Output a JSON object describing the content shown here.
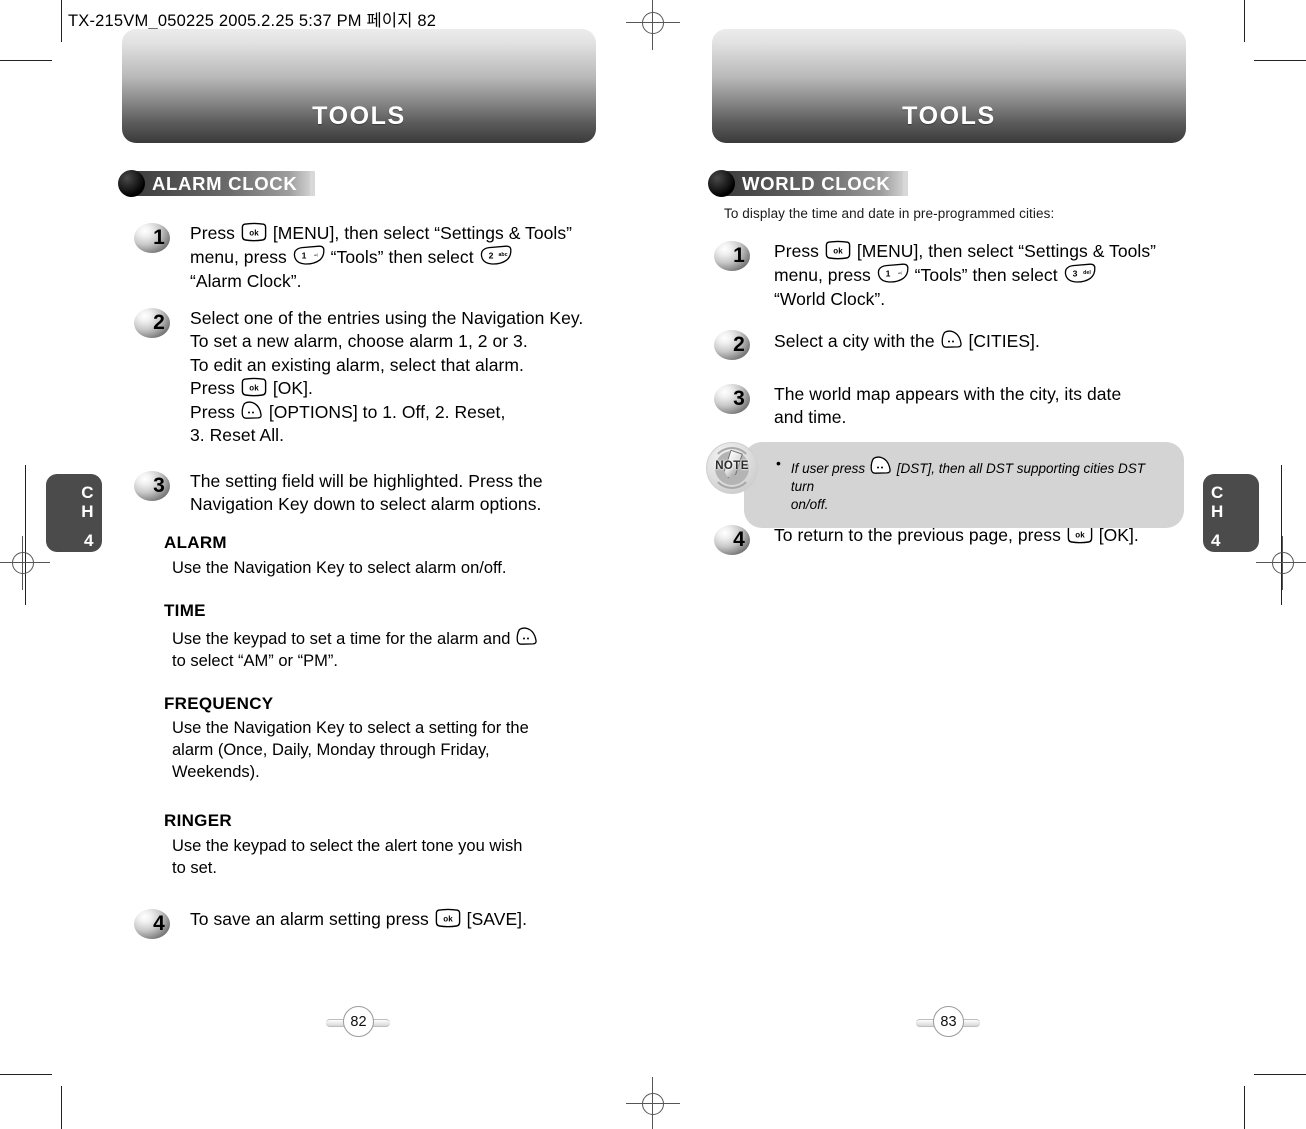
{
  "document": {
    "header_line": "TX-215VM_050225  2005.2.25 5:37 PM 페이지 82"
  },
  "chapter_tabs": {
    "left": {
      "c": "C",
      "h": "H",
      "num": "4"
    },
    "right": {
      "c": "C",
      "h": "H",
      "num": "4"
    }
  },
  "pages": [
    {
      "banner_title": "TOOLS",
      "page_number": "82",
      "section": {
        "label": "ALARM CLOCK"
      },
      "intro": "",
      "steps": [
        {
          "number": "1",
          "lines": [
            {
              "parts": [
                {
                  "type": "text",
                  "value": "Press "
                },
                {
                  "type": "key",
                  "key": "ok",
                  "label": "ok"
                },
                {
                  "type": "text",
                  "value": " [MENU], then select “Settings & Tools”"
                }
              ]
            },
            {
              "parts": [
                {
                  "type": "text",
                  "value": "menu, press "
                },
                {
                  "type": "key",
                  "key": "num",
                  "label": "1",
                  "sub": "₀₍"
                },
                {
                  "type": "text",
                  "value": " “Tools” then select "
                },
                {
                  "type": "key",
                  "key": "num",
                  "label": "2",
                  "sub": "abc"
                }
              ]
            },
            {
              "parts": [
                {
                  "type": "text",
                  "value": "“Alarm Clock”."
                }
              ]
            }
          ]
        },
        {
          "number": "2",
          "lines": [
            {
              "parts": [
                {
                  "type": "text",
                  "value": "Select one of the entries using the Navigation Key."
                }
              ]
            },
            {
              "parts": [
                {
                  "type": "text",
                  "value": "To set a new alarm, choose alarm 1, 2 or 3."
                }
              ]
            },
            {
              "parts": [
                {
                  "type": "text",
                  "value": "To edit an existing alarm, select that alarm."
                }
              ]
            },
            {
              "parts": [
                {
                  "type": "text",
                  "value": "Press "
                },
                {
                  "type": "key",
                  "key": "ok",
                  "label": "ok"
                },
                {
                  "type": "text",
                  "value": " [OK]."
                }
              ]
            },
            {
              "parts": [
                {
                  "type": "text",
                  "value": "Press "
                },
                {
                  "type": "key",
                  "key": "soft"
                },
                {
                  "type": "text",
                  "value": " [OPTIONS] to 1. Off, 2. Reset,"
                }
              ]
            },
            {
              "parts": [
                {
                  "type": "text",
                  "value": "3. Reset All."
                }
              ]
            }
          ]
        },
        {
          "number": "3",
          "lines": [
            {
              "parts": [
                {
                  "type": "text",
                  "value": "The setting field will be highlighted. Press the"
                }
              ]
            },
            {
              "parts": [
                {
                  "type": "text",
                  "value": "Navigation Key down to select alarm options."
                }
              ]
            }
          ]
        },
        {
          "number": "4",
          "lines": [
            {
              "parts": [
                {
                  "type": "text",
                  "value": "To save an alarm setting press "
                },
                {
                  "type": "key",
                  "key": "ok",
                  "label": "ok"
                },
                {
                  "type": "text",
                  "value": " [SAVE]."
                }
              ]
            }
          ]
        }
      ],
      "subsections": [
        {
          "heading": "ALARM",
          "lines": [
            {
              "parts": [
                {
                  "type": "text",
                  "value": "Use the Navigation Key to select alarm on/off."
                }
              ]
            }
          ]
        },
        {
          "heading": "TIME",
          "lines": [
            {
              "parts": [
                {
                  "type": "text",
                  "value": "Use the keypad to set a time for the alarm and "
                },
                {
                  "type": "key",
                  "key": "soft"
                }
              ]
            },
            {
              "parts": [
                {
                  "type": "text",
                  "value": "to select “AM” or “PM”."
                }
              ]
            }
          ]
        },
        {
          "heading": "FREQUENCY",
          "lines": [
            {
              "parts": [
                {
                  "type": "text",
                  "value": "Use the Navigation Key to select a setting for the"
                }
              ]
            },
            {
              "parts": [
                {
                  "type": "text",
                  "value": "alarm (Once, Daily, Monday through Friday,"
                }
              ]
            },
            {
              "parts": [
                {
                  "type": "text",
                  "value": "Weekends)."
                }
              ]
            }
          ]
        },
        {
          "heading": "RINGER",
          "lines": [
            {
              "parts": [
                {
                  "type": "text",
                  "value": "Use the keypad to select the alert tone you wish"
                }
              ]
            },
            {
              "parts": [
                {
                  "type": "text",
                  "value": "to set."
                }
              ]
            }
          ]
        }
      ]
    },
    {
      "banner_title": "TOOLS",
      "page_number": "83",
      "section": {
        "label": "WORLD CLOCK"
      },
      "intro": "To display the time and date in pre-programmed cities:",
      "steps": [
        {
          "number": "1",
          "lines": [
            {
              "parts": [
                {
                  "type": "text",
                  "value": "Press "
                },
                {
                  "type": "key",
                  "key": "ok",
                  "label": "ok"
                },
                {
                  "type": "text",
                  "value": " [MENU], then select “Settings & Tools”"
                }
              ]
            },
            {
              "parts": [
                {
                  "type": "text",
                  "value": "menu, press "
                },
                {
                  "type": "key",
                  "key": "num",
                  "label": "1",
                  "sub": "₀₍"
                },
                {
                  "type": "text",
                  "value": " “Tools” then select "
                },
                {
                  "type": "key",
                  "key": "num",
                  "label": "3",
                  "sub": "del"
                }
              ]
            },
            {
              "parts": [
                {
                  "type": "text",
                  "value": "“World Clock”."
                }
              ]
            }
          ]
        },
        {
          "number": "2",
          "lines": [
            {
              "parts": [
                {
                  "type": "text",
                  "value": "Select a city with the "
                },
                {
                  "type": "key",
                  "key": "soft"
                },
                {
                  "type": "text",
                  "value": " [CITIES]."
                }
              ]
            }
          ]
        },
        {
          "number": "3",
          "lines": [
            {
              "parts": [
                {
                  "type": "text",
                  "value": "The world map appears with the city, its date"
                }
              ]
            },
            {
              "parts": [
                {
                  "type": "text",
                  "value": "and time."
                }
              ]
            }
          ]
        },
        {
          "number": "4",
          "lines": [
            {
              "parts": [
                {
                  "type": "text",
                  "value": "To return to the previous page, press "
                },
                {
                  "type": "key",
                  "key": "ok",
                  "label": "ok"
                },
                {
                  "type": "text",
                  "value": " [OK]."
                }
              ]
            }
          ]
        }
      ],
      "note": {
        "badge_label": "NOTE",
        "bullet": "•",
        "lines": [
          {
            "parts": [
              {
                "type": "text",
                "value": "If user press "
              },
              {
                "type": "key",
                "key": "soft"
              },
              {
                "type": "text",
                "value": " [DST], then all DST supporting cities DST turn"
              }
            ]
          },
          {
            "parts": [
              {
                "type": "text",
                "value": "on/off."
              }
            ]
          }
        ]
      },
      "subsections": []
    }
  ],
  "colors": {
    "banner_top": "#ececec",
    "banner_bottom": "#3a3a3a",
    "tab_bg": "#4b4b4b",
    "note_bg": "#d4d4d4",
    "text": "#000000"
  }
}
